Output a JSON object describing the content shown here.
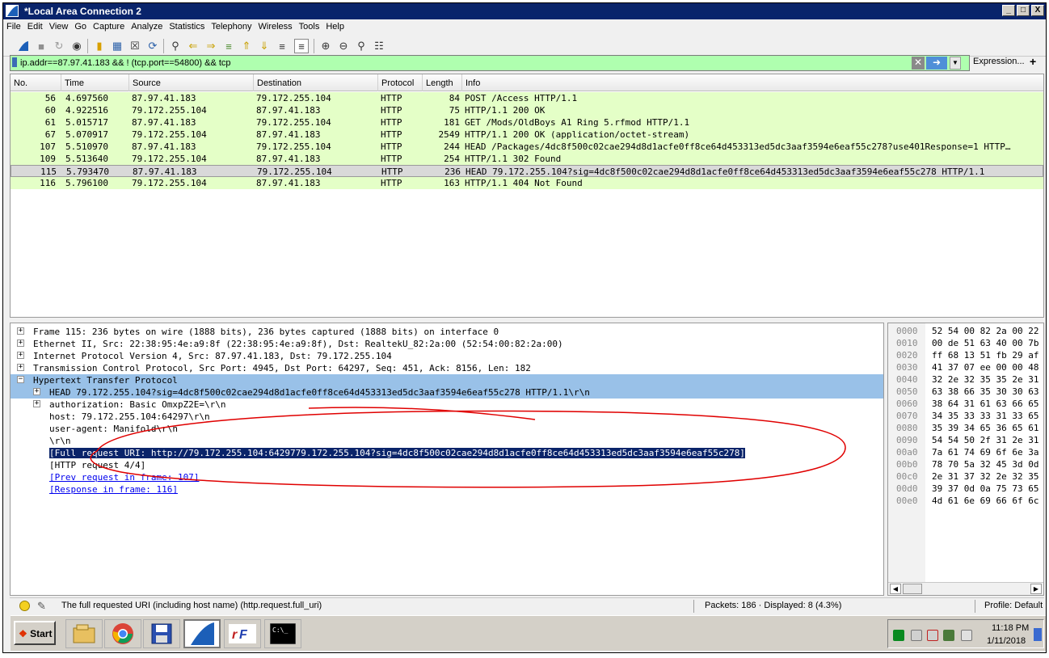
{
  "window": {
    "title": "*Local Area Connection 2",
    "buttons": [
      "_",
      "□",
      "X"
    ]
  },
  "menu": [
    "File",
    "Edit",
    "View",
    "Go",
    "Capture",
    "Analyze",
    "Statistics",
    "Telephony",
    "Wireless",
    "Tools",
    "Help"
  ],
  "filter": {
    "value": "ip.addr==87.97.41.183 && ! (tcp.port==54800) && tcp",
    "expression_label": "Expression...",
    "plus_label": "+"
  },
  "packet_list": {
    "columns": [
      "No.",
      "Time",
      "Source",
      "Destination",
      "Protocol",
      "Length",
      "Info"
    ],
    "rows": [
      {
        "no": "56",
        "time": "4.697560",
        "src": "87.97.41.183",
        "dst": "79.172.255.104",
        "proto": "HTTP",
        "len": "84",
        "info": "POST /Access HTTP/1.1"
      },
      {
        "no": "60",
        "time": "4.922516",
        "src": "79.172.255.104",
        "dst": "87.97.41.183",
        "proto": "HTTP",
        "len": "75",
        "info": "HTTP/1.1 200 OK"
      },
      {
        "no": "61",
        "time": "5.015717",
        "src": "87.97.41.183",
        "dst": "79.172.255.104",
        "proto": "HTTP",
        "len": "181",
        "info": "GET /Mods/OldBoys A1 Ring 5.rfmod HTTP/1.1"
      },
      {
        "no": "67",
        "time": "5.070917",
        "src": "79.172.255.104",
        "dst": "87.97.41.183",
        "proto": "HTTP",
        "len": "2549",
        "info": "HTTP/1.1 200 OK  (application/octet-stream)"
      },
      {
        "no": "107",
        "time": "5.510970",
        "src": "87.97.41.183",
        "dst": "79.172.255.104",
        "proto": "HTTP",
        "len": "244",
        "info": "HEAD /Packages/4dc8f500c02cae294d8d1acfe0ff8ce64d453313ed5dc3aaf3594e6eaf55c278?use401Response=1 HTTP…"
      },
      {
        "no": "109",
        "time": "5.513640",
        "src": "79.172.255.104",
        "dst": "87.97.41.183",
        "proto": "HTTP",
        "len": "254",
        "info": "HTTP/1.1 302 Found"
      },
      {
        "no": "115",
        "time": "5.793470",
        "src": "87.97.41.183",
        "dst": "79.172.255.104",
        "proto": "HTTP",
        "len": "236",
        "info": "HEAD 79.172.255.104?sig=4dc8f500c02cae294d8d1acfe0ff8ce64d453313ed5dc3aaf3594e6eaf55c278 HTTP/1.1"
      },
      {
        "no": "116",
        "time": "5.796100",
        "src": "79.172.255.104",
        "dst": "87.97.41.183",
        "proto": "HTTP",
        "len": "163",
        "info": "HTTP/1.1 404 Not Found"
      }
    ]
  },
  "details": [
    {
      "text": "Frame 115: 236 bytes on wire (1888 bits), 236 bytes captured (1888 bits) on interface 0",
      "expander": "+"
    },
    {
      "text": "Ethernet II, Src: 22:38:95:4e:a9:8f (22:38:95:4e:a9:8f), Dst: RealtekU_82:2a:00 (52:54:00:82:2a:00)",
      "expander": "+"
    },
    {
      "text": "Internet Protocol Version 4, Src: 87.97.41.183, Dst: 79.172.255.104",
      "expander": "+"
    },
    {
      "text": "Transmission Control Protocol, Src Port: 4945, Dst Port: 64297, Seq: 451, Ack: 8156, Len: 182",
      "expander": "+"
    },
    {
      "text": "Hypertext Transfer Protocol",
      "expander": "−"
    },
    {
      "text": "HEAD 79.172.255.104?sig=4dc8f500c02cae294d8d1acfe0ff8ce64d453313ed5dc3aaf3594e6eaf55c278 HTTP/1.1\\r\\n",
      "expander": "+"
    },
    {
      "text": "authorization: Basic OmxpZ2E=\\r\\n",
      "expander": "+"
    },
    {
      "text": "host: 79.172.255.104:64297\\r\\n",
      "expander": ""
    },
    {
      "text": "user-agent: Manifold\\r\\n",
      "expander": ""
    },
    {
      "text": "\\r\\n",
      "expander": ""
    },
    {
      "text": "[Full request URI: http://79.172.255.104:6429779.172.255.104?sig=4dc8f500c02cae294d8d1acfe0ff8ce64d453313ed5dc3aaf3594e6eaf55c278]",
      "expander": ""
    },
    {
      "text": "[HTTP request 4/4]",
      "expander": ""
    },
    {
      "text": "[Prev request in frame: 107]",
      "expander": ""
    },
    {
      "text": "[Response in frame: 116]",
      "expander": ""
    }
  ],
  "bytes": [
    {
      "off": "0000",
      "hex": "52 54 00 82 2a 00 22"
    },
    {
      "off": "0010",
      "hex": "00 de 51 63 40 00 7b"
    },
    {
      "off": "0020",
      "hex": "ff 68 13 51 fb 29 af"
    },
    {
      "off": "0030",
      "hex": "41 37 07 ee 00 00 48"
    },
    {
      "off": "0040",
      "hex": "32 2e 32 35 35 2e 31"
    },
    {
      "off": "0050",
      "hex": "63 38 66 35 30 30 63"
    },
    {
      "off": "0060",
      "hex": "38 64 31 61 63 66 65"
    },
    {
      "off": "0070",
      "hex": "34 35 33 33 31 33 65"
    },
    {
      "off": "0080",
      "hex": "35 39 34 65 36 65 61"
    },
    {
      "off": "0090",
      "hex": "54 54 50 2f 31 2e 31"
    },
    {
      "off": "00a0",
      "hex": "7a 61 74 69 6f 6e 3a"
    },
    {
      "off": "00b0",
      "hex": "78 70 5a 32 45 3d 0d"
    },
    {
      "off": "00c0",
      "hex": "2e 31 37 32 2e 32 35"
    },
    {
      "off": "00d0",
      "hex": "39 37 0d 0a 75 73 65"
    },
    {
      "off": "00e0",
      "hex": "4d 61 6e 69 66 6f 6c"
    }
  ],
  "status": {
    "field_info": "The full requested URI (including host name) (http.request.full_uri)",
    "packets": "Packets: 186 · Displayed: 8 (4.3%)",
    "profile": "Profile: Default"
  },
  "taskbar": {
    "start_label": "Start",
    "time": "11:18 PM",
    "date": "1/11/2018",
    "apps": [
      "explorer-icon",
      "chrome-icon",
      "floppy-save-icon",
      "wireshark-icon",
      "rfactor-icon",
      "cmd-icon"
    ]
  },
  "colors": {
    "title_bar": "#0a246a",
    "filter_valid": "#afffaf",
    "row_http": "#e4ffc7",
    "tree_highlight": "#99c1e8",
    "selected": "#0a246a",
    "annotation": "#e00000"
  }
}
